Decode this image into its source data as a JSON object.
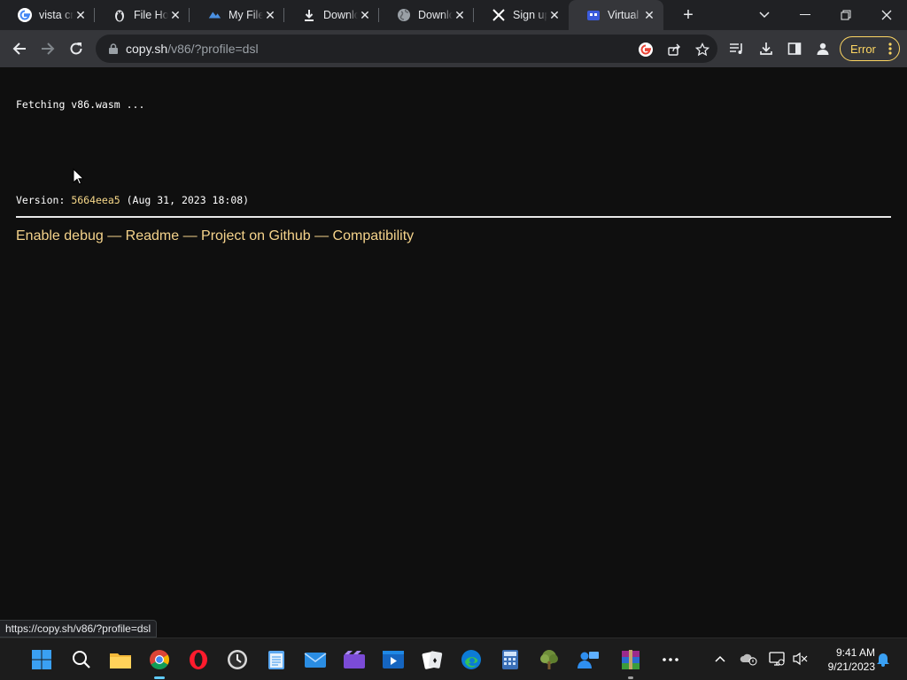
{
  "browser": {
    "tabs": [
      {
        "title": "vista cm",
        "icon": "google-icon"
      },
      {
        "title": "File Hos",
        "icon": "linux-tux-icon"
      },
      {
        "title": "My Files",
        "icon": "cloud-icon"
      },
      {
        "title": "Downlo",
        "icon": "download-icon"
      },
      {
        "title": "Downlo",
        "icon": "globe-icon"
      },
      {
        "title": "Sign up",
        "icon": "x-logo-icon"
      },
      {
        "title": "Virtual",
        "icon": "v86-icon",
        "active": true
      }
    ],
    "address": {
      "host": "copy.sh",
      "path": "/v86/?profile=dsl"
    },
    "error_label": "Error",
    "status_url": "https://copy.sh/v86/?profile=dsl"
  },
  "page": {
    "fetching": "Fetching v86.wasm ...",
    "version_label": "Version: ",
    "version_hash": "5664eea5",
    "version_date": " (Aug 31, 2023 18:08)",
    "links": [
      {
        "label": "Enable debug"
      },
      {
        "label": "Readme"
      },
      {
        "label": "Project on Github"
      },
      {
        "label": "Compatibility"
      }
    ],
    "link_separator": " — "
  },
  "taskbar": {
    "apps": [
      "start-icon",
      "search-icon",
      "file-explorer-icon",
      "chrome-icon",
      "opera-icon",
      "clock-app-icon",
      "notepad-icon",
      "mail-icon",
      "clipchamp-icon",
      "movies-icon",
      "solitaire-icon",
      "edge-icon",
      "calculator-icon",
      "tree-app-icon",
      "people-app-icon",
      "winrar-icon",
      "more-icon"
    ],
    "time": "9:41 AM",
    "date": "9/21/2023"
  },
  "colors": {
    "accent_link": "#f5d38b",
    "error": "#fdd663",
    "hash": "#f7d889"
  }
}
